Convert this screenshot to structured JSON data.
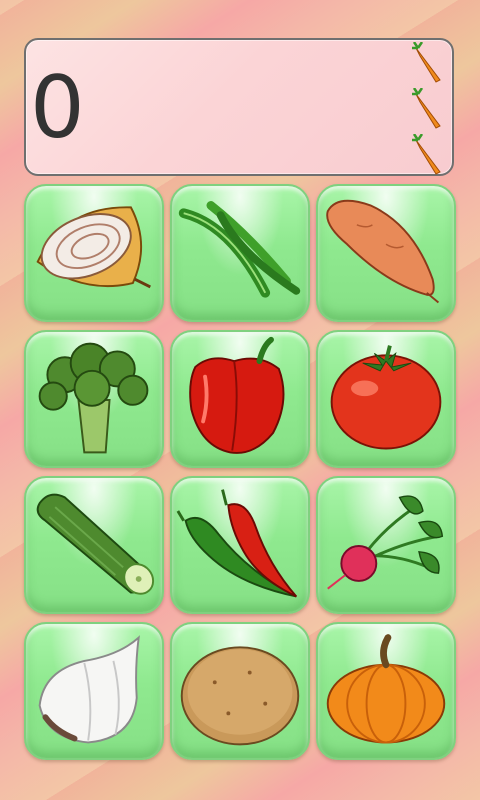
{
  "score": "0",
  "lives": {
    "count": 3,
    "icon": "carrot-icon"
  },
  "tiles": [
    {
      "name": "onion",
      "icon": "onion-icon"
    },
    {
      "name": "green-beans",
      "icon": "green-beans-icon"
    },
    {
      "name": "sweet-potato",
      "icon": "sweet-potato-icon"
    },
    {
      "name": "broccoli",
      "icon": "broccoli-icon"
    },
    {
      "name": "red-pepper",
      "icon": "red-pepper-icon"
    },
    {
      "name": "tomato",
      "icon": "tomato-icon"
    },
    {
      "name": "cucumber",
      "icon": "cucumber-icon"
    },
    {
      "name": "chili-peppers",
      "icon": "chili-peppers-icon"
    },
    {
      "name": "radish",
      "icon": "radish-icon"
    },
    {
      "name": "garlic",
      "icon": "garlic-icon"
    },
    {
      "name": "potato",
      "icon": "potato-icon"
    },
    {
      "name": "pumpkin",
      "icon": "pumpkin-icon"
    }
  ],
  "colors": {
    "tile": "#8fe98f",
    "display_bg": "#fbd4d6",
    "score_text": "#333333"
  }
}
